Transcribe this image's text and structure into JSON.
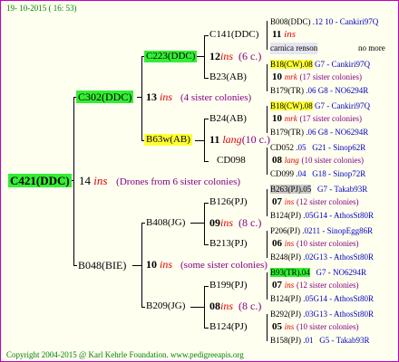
{
  "header_date": "19- 10-2015 ( 16: 53)",
  "footer": "Copyright 2004-2015 @ Karl Kehrle Foundation.   www.pedigreeapis.org",
  "root": {
    "id": "C421(DDC)",
    "year": "14",
    "ins": "ins",
    "note": "(Drones from 6 sister colonies)"
  },
  "upper": {
    "node": {
      "id": "C302(DDC)",
      "year": "13",
      "ins": "ins",
      "note": "(4 sister colonies)"
    },
    "left": {
      "id": "C223(DDC)",
      "year": "12",
      "ins": "ins",
      "note": "(6 c.)"
    },
    "c141": {
      "id": "C141(DDC)",
      "year": "11",
      "ins": "ins"
    },
    "b008": {
      "id": "B008(DDC)",
      "suffix": ".12",
      "tag": "10 - Cankiri97Q"
    },
    "carnica": {
      "label": "carnica renson",
      "more": "no more"
    },
    "b23": {
      "id": "B23(AB)"
    },
    "b18a": {
      "id": "B18(CW)",
      "suffix": ".08",
      "tag": "G7 - Cankiri97Q"
    },
    "b23_year": {
      "year": "10",
      "ins": "mrk",
      "note": "(17 sister colonies)"
    },
    "b179a": {
      "id": "B179(TR)",
      "suffix": ".06",
      "tag": "G8 - NO6294R"
    },
    "b63w": {
      "id": "B63w(AB)",
      "year": "11",
      "ins": "lang",
      "note": "(10 c.)"
    },
    "b24": {
      "id": "B24(AB)"
    },
    "b18b": {
      "id": "B18(CW)",
      "suffix": ".08",
      "tag": "G7 - Cankiri97Q"
    },
    "b24_year": {
      "year": "10",
      "ins": "mrk",
      "note": "(17 sister colonies)"
    },
    "b179b": {
      "id": "B179(TR)",
      "suffix": ".06",
      "tag": "G8 - NO6294R"
    },
    "cd098": {
      "id": "CD098"
    },
    "cd052": {
      "id": "CD052",
      "suffix": ".05",
      "tag": "G21 - Sinop62R"
    },
    "cd098_year": {
      "year": "08",
      "ins": "lang",
      "note": "(10 sister colonies)"
    },
    "cd099": {
      "id": "CD099",
      "suffix": ".04",
      "tag": "G18 - Sinop72R"
    }
  },
  "lower": {
    "node": {
      "id": "B048(BIE)",
      "year": "10",
      "ins": "ins",
      "note": "(some sister colonies)"
    },
    "b408": {
      "id": "B408(JG)",
      "year": "09",
      "ins": "ins",
      "note": "(8 c.)"
    },
    "b126": {
      "id": "B126(PJ)"
    },
    "b263": {
      "id": "B263(PJ)",
      "suffix": ".05",
      "tag": "G7 - Takab93R"
    },
    "b126_year": {
      "year": "07",
      "ins": "ins",
      "note": "(12 sister colonies)"
    },
    "b124a": {
      "id": "B124(PJ)",
      "suffix": ".05",
      "tag": "G14 - AthosSt80R"
    },
    "b213": {
      "id": "B213(PJ)"
    },
    "p206": {
      "id": "P206(PJ)",
      "suffix": ".02",
      "tag": "11 - SinopEgg86R"
    },
    "b213_year": {
      "year": "06",
      "ins": "ins",
      "note": "(10 sister colonies)"
    },
    "b248": {
      "id": "B248(PJ)",
      "suffix": ".02",
      "tag": "G13 - AthosSt80R"
    },
    "b209": {
      "id": "B209(JG)",
      "year": "08",
      "ins": "ins",
      "note": "(8 c.)"
    },
    "b199": {
      "id": "B199(PJ)"
    },
    "b93": {
      "id": "B93(TR)",
      "suffix": ".04",
      "tag": "G7 - NO6294R"
    },
    "b199_year": {
      "year": "07",
      "ins": "ins",
      "note": "(12 sister colonies)"
    },
    "b124b": {
      "id": "B124(PJ)",
      "suffix": ".05",
      "tag": "G14 - AthosSt80R"
    },
    "b124c": {
      "id": "B124(PJ)"
    },
    "b292": {
      "id": "B292(PJ)",
      "suffix": ".03",
      "tag": "G13 - AthosSt80R"
    },
    "b124c_year": {
      "year": "05",
      "ins": "ins",
      "note": "(10 sister colonies)"
    },
    "b158": {
      "id": "B158(PJ)",
      "suffix": ".01",
      "tag": "G5 - Takab93R"
    }
  }
}
